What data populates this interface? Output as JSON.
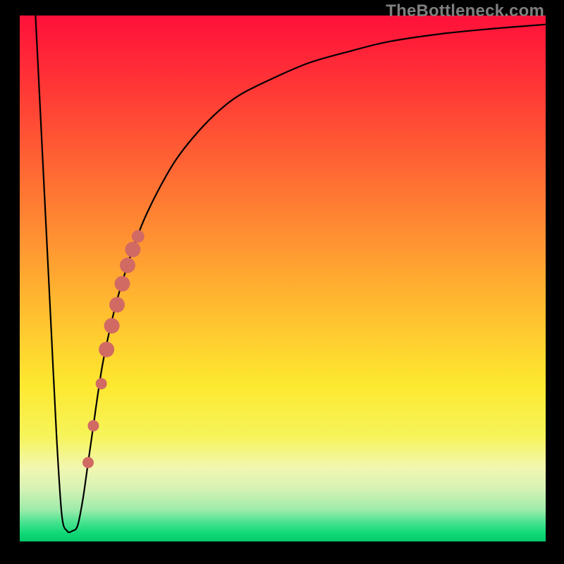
{
  "watermark": "TheBottleneck.com",
  "colors": {
    "frame": "#000000",
    "line": "#000000",
    "marker": "#d26a64",
    "gradient_stops": [
      {
        "offset": 0.0,
        "color": "#ff103a"
      },
      {
        "offset": 0.1,
        "color": "#ff2c37"
      },
      {
        "offset": 0.25,
        "color": "#ff5a34"
      },
      {
        "offset": 0.4,
        "color": "#ff8a32"
      },
      {
        "offset": 0.55,
        "color": "#ffba30"
      },
      {
        "offset": 0.7,
        "color": "#fde82f"
      },
      {
        "offset": 0.8,
        "color": "#f6f45a"
      },
      {
        "offset": 0.86,
        "color": "#f2f7b0"
      },
      {
        "offset": 0.9,
        "color": "#d6f2b4"
      },
      {
        "offset": 0.94,
        "color": "#9debaa"
      },
      {
        "offset": 0.965,
        "color": "#44e28e"
      },
      {
        "offset": 0.985,
        "color": "#0fd876"
      },
      {
        "offset": 1.0,
        "color": "#05c96d"
      }
    ]
  },
  "chart_data": {
    "type": "line",
    "title": "",
    "xlabel": "",
    "ylabel": "",
    "xlim": [
      0,
      100
    ],
    "ylim": [
      0,
      100
    ],
    "series": [
      {
        "name": "bottleneck-curve",
        "x": [
          3,
          4,
          5,
          6,
          7,
          8,
          9,
          10,
          11,
          12,
          13,
          14,
          15,
          16,
          18,
          20,
          22,
          24,
          27,
          30,
          34,
          38,
          42,
          48,
          55,
          62,
          70,
          80,
          90,
          100
        ],
        "y": [
          100,
          80,
          60,
          40,
          20,
          5,
          2,
          2,
          3,
          8,
          15,
          22,
          29,
          35,
          44,
          51,
          57,
          62,
          68,
          73,
          78,
          82,
          85,
          88,
          91,
          93,
          95,
          96.5,
          97.5,
          98.3
        ]
      }
    ],
    "markers": [
      {
        "x": 13.0,
        "y": 15,
        "r": 8
      },
      {
        "x": 14.0,
        "y": 22,
        "r": 8
      },
      {
        "x": 15.5,
        "y": 30,
        "r": 8
      },
      {
        "x": 16.5,
        "y": 36.5,
        "r": 11
      },
      {
        "x": 17.5,
        "y": 41,
        "r": 11
      },
      {
        "x": 18.5,
        "y": 45,
        "r": 11
      },
      {
        "x": 19.5,
        "y": 49,
        "r": 11
      },
      {
        "x": 20.5,
        "y": 52.5,
        "r": 11
      },
      {
        "x": 21.5,
        "y": 55.5,
        "r": 11
      },
      {
        "x": 22.5,
        "y": 58,
        "r": 9
      }
    ]
  }
}
